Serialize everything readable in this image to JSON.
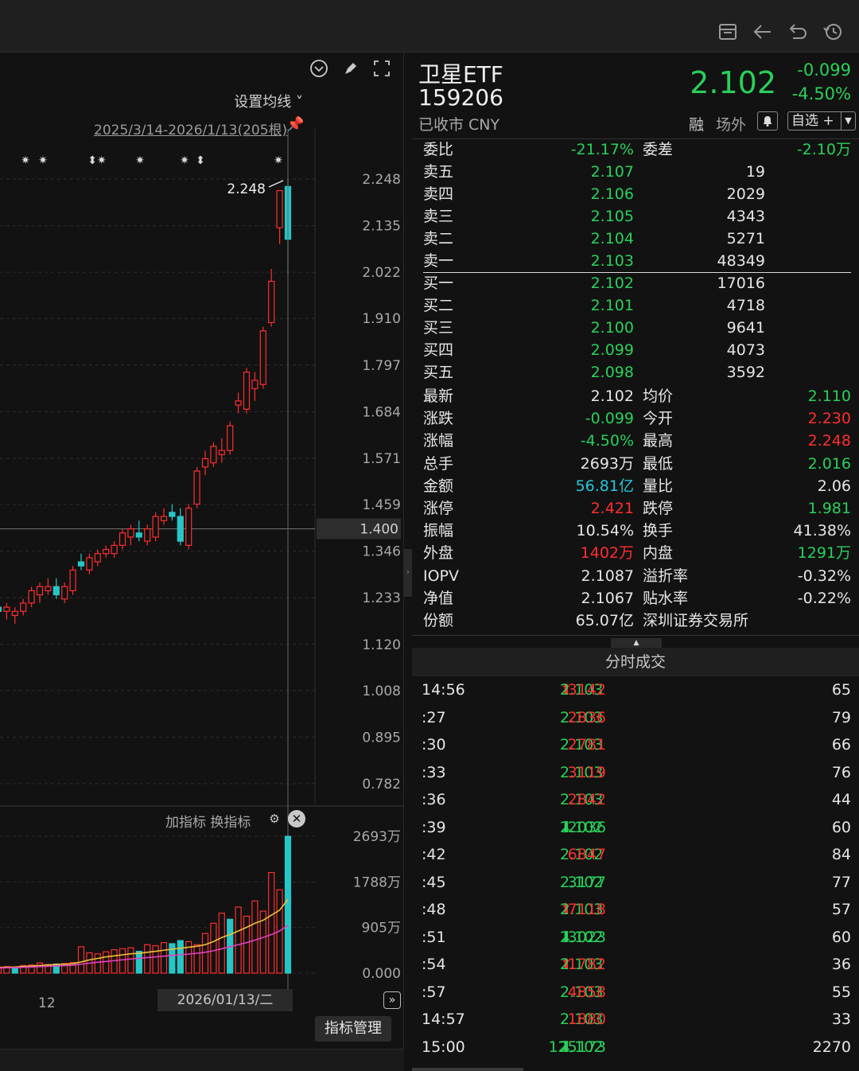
{
  "topbar": {
    "icons": [
      "layout-icon",
      "back-arrow-icon",
      "undo-icon",
      "history-icon"
    ]
  },
  "chart": {
    "ma_setting": "设置均线 ˅",
    "range": "2025/3/14-2026/1/13(205根)",
    "ind_add": "加指标",
    "ind_switch": "换指标",
    "date_box": "2026/01/13/二",
    "x_tick": "12",
    "ind_manage": "指标管理",
    "marker_label": "2.248"
  },
  "chart_data": [
    {
      "type": "candlestick",
      "title": "",
      "y_ticks": [
        "2.248",
        "2.135",
        "2.022",
        "1.910",
        "1.797",
        "1.684",
        "1.571",
        "1.459",
        "1.346",
        "1.233",
        "1.120",
        "1.008",
        "0.895",
        "0.782"
      ],
      "ylim": [
        0.782,
        2.248
      ],
      "crosshair_price": "1.400",
      "max_label": "2.248",
      "candles": [
        {
          "o": 1.21,
          "h": 1.23,
          "l": 1.19,
          "c": 1.2
        },
        {
          "o": 1.2,
          "h": 1.22,
          "l": 1.18,
          "c": 1.21
        },
        {
          "o": 1.19,
          "h": 1.21,
          "l": 1.17,
          "c": 1.2
        },
        {
          "o": 1.2,
          "h": 1.23,
          "l": 1.19,
          "c": 1.22
        },
        {
          "o": 1.22,
          "h": 1.26,
          "l": 1.21,
          "c": 1.25
        },
        {
          "o": 1.24,
          "h": 1.27,
          "l": 1.22,
          "c": 1.26
        },
        {
          "o": 1.25,
          "h": 1.28,
          "l": 1.24,
          "c": 1.26
        },
        {
          "o": 1.26,
          "h": 1.28,
          "l": 1.23,
          "c": 1.24
        },
        {
          "o": 1.23,
          "h": 1.27,
          "l": 1.22,
          "c": 1.26
        },
        {
          "o": 1.25,
          "h": 1.31,
          "l": 1.24,
          "c": 1.3
        },
        {
          "o": 1.32,
          "h": 1.34,
          "l": 1.3,
          "c": 1.31
        },
        {
          "o": 1.3,
          "h": 1.34,
          "l": 1.29,
          "c": 1.33
        },
        {
          "o": 1.32,
          "h": 1.35,
          "l": 1.31,
          "c": 1.34
        },
        {
          "o": 1.34,
          "h": 1.36,
          "l": 1.33,
          "c": 1.35
        },
        {
          "o": 1.34,
          "h": 1.37,
          "l": 1.33,
          "c": 1.36
        },
        {
          "o": 1.36,
          "h": 1.4,
          "l": 1.35,
          "c": 1.39
        },
        {
          "o": 1.38,
          "h": 1.41,
          "l": 1.36,
          "c": 1.4
        },
        {
          "o": 1.39,
          "h": 1.42,
          "l": 1.37,
          "c": 1.38
        },
        {
          "o": 1.37,
          "h": 1.41,
          "l": 1.36,
          "c": 1.4
        },
        {
          "o": 1.38,
          "h": 1.44,
          "l": 1.37,
          "c": 1.43
        },
        {
          "o": 1.42,
          "h": 1.45,
          "l": 1.41,
          "c": 1.43
        },
        {
          "o": 1.44,
          "h": 1.46,
          "l": 1.42,
          "c": 1.43
        },
        {
          "o": 1.43,
          "h": 1.45,
          "l": 1.36,
          "c": 1.37
        },
        {
          "o": 1.36,
          "h": 1.46,
          "l": 1.35,
          "c": 1.45
        },
        {
          "o": 1.46,
          "h": 1.55,
          "l": 1.45,
          "c": 1.54
        },
        {
          "o": 1.55,
          "h": 1.59,
          "l": 1.53,
          "c": 1.57
        },
        {
          "o": 1.56,
          "h": 1.61,
          "l": 1.55,
          "c": 1.6
        },
        {
          "o": 1.58,
          "h": 1.62,
          "l": 1.56,
          "c": 1.59
        },
        {
          "o": 1.59,
          "h": 1.66,
          "l": 1.58,
          "c": 1.65
        },
        {
          "o": 1.7,
          "h": 1.73,
          "l": 1.68,
          "c": 1.71
        },
        {
          "o": 1.69,
          "h": 1.79,
          "l": 1.68,
          "c": 1.78
        },
        {
          "o": 1.74,
          "h": 1.78,
          "l": 1.71,
          "c": 1.76
        },
        {
          "o": 1.75,
          "h": 1.89,
          "l": 1.74,
          "c": 1.88
        },
        {
          "o": 1.9,
          "h": 2.03,
          "l": 1.89,
          "c": 2.0
        },
        {
          "o": 2.13,
          "h": 2.14,
          "l": 2.09,
          "c": 2.22
        },
        {
          "o": 2.23,
          "h": 2.248,
          "l": 2.016,
          "c": 2.102
        }
      ]
    },
    {
      "type": "bar",
      "title": "",
      "y_ticks": [
        "2693万",
        "1788万",
        "905万",
        "0.000"
      ],
      "ylim": [
        0,
        2693
      ],
      "values": [
        120,
        130,
        110,
        150,
        160,
        200,
        170,
        180,
        190,
        210,
        520,
        400,
        380,
        420,
        460,
        480,
        500,
        430,
        560,
        540,
        600,
        580,
        640,
        620,
        560,
        780,
        980,
        1180,
        1060,
        1300,
        1120,
        1420,
        1220,
        1980,
        1640,
        2693
      ],
      "up": [
        true,
        true,
        false,
        true,
        true,
        true,
        true,
        false,
        true,
        true,
        true,
        true,
        true,
        true,
        true,
        true,
        true,
        false,
        true,
        true,
        true,
        false,
        false,
        true,
        true,
        true,
        true,
        true,
        false,
        true,
        true,
        true,
        true,
        true,
        true,
        false
      ],
      "ma_short": [
        110,
        115,
        120,
        130,
        140,
        150,
        160,
        170,
        175,
        185,
        220,
        260,
        290,
        320,
        340,
        360,
        380,
        390,
        410,
        430,
        450,
        470,
        490,
        510,
        530,
        560,
        620,
        700,
        760,
        830,
        900,
        980,
        1040,
        1140,
        1240,
        1450
      ],
      "ma_long": [
        100,
        104,
        108,
        114,
        120,
        128,
        136,
        142,
        148,
        156,
        176,
        196,
        214,
        230,
        246,
        262,
        278,
        292,
        306,
        320,
        334,
        348,
        362,
        376,
        390,
        410,
        440,
        480,
        520,
        560,
        600,
        650,
        700,
        760,
        830,
        940
      ]
    }
  ],
  "security": {
    "name": "卫星ETF",
    "code": "159206",
    "status": "已收市 CNY",
    "price": "2.102",
    "change": "-0.099",
    "change_pct": "-4.50%",
    "tag_rong": "融",
    "tag_chw": "场外",
    "fav": "自选 +"
  },
  "book": {
    "weibi_label": "委比",
    "weibi": "-21.17%",
    "weicha_label": "委差",
    "weicha": "-2.10万",
    "asks": [
      {
        "label": "卖五",
        "price": "2.107",
        "vol": "19"
      },
      {
        "label": "卖四",
        "price": "2.106",
        "vol": "2029"
      },
      {
        "label": "卖三",
        "price": "2.105",
        "vol": "4343"
      },
      {
        "label": "卖二",
        "price": "2.104",
        "vol": "5271"
      },
      {
        "label": "卖一",
        "price": "2.103",
        "vol": "48349"
      }
    ],
    "bids": [
      {
        "label": "买一",
        "price": "2.102",
        "vol": "17016"
      },
      {
        "label": "买二",
        "price": "2.101",
        "vol": "4718"
      },
      {
        "label": "买三",
        "price": "2.100",
        "vol": "9641"
      },
      {
        "label": "买四",
        "price": "2.099",
        "vol": "4073"
      },
      {
        "label": "买五",
        "price": "2.098",
        "vol": "3592"
      }
    ]
  },
  "stats": [
    {
      "l1": "最新",
      "v1": "2.102",
      "c1": "white",
      "l2": "均价",
      "v2": "2.110",
      "c2": "green"
    },
    {
      "l1": "涨跌",
      "v1": "-0.099",
      "c1": "green",
      "l2": "今开",
      "v2": "2.230",
      "c2": "red"
    },
    {
      "l1": "涨幅",
      "v1": "-4.50%",
      "c1": "green",
      "l2": "最高",
      "v2": "2.248",
      "c2": "red"
    },
    {
      "l1": "总手",
      "v1": "2693万",
      "c1": "white",
      "l2": "最低",
      "v2": "2.016",
      "c2": "green"
    },
    {
      "l1": "金额",
      "v1": "56.81亿",
      "c1": "cyan",
      "l2": "量比",
      "v2": "2.06",
      "c2": "white"
    },
    {
      "l1": "涨停",
      "v1": "2.421",
      "c1": "red",
      "l2": "跌停",
      "v2": "1.981",
      "c2": "green"
    },
    {
      "l1": "振幅",
      "v1": "10.54%",
      "c1": "white",
      "l2": "换手",
      "v2": "41.38%",
      "c2": "white"
    },
    {
      "l1": "外盘",
      "v1": "1402万",
      "c1": "red",
      "l2": "内盘",
      "v2": "1291万",
      "c2": "green"
    },
    {
      "l1": "IOPV",
      "v1": "2.1087",
      "c1": "white",
      "l2": "溢折率",
      "v2": "-0.32%",
      "c2": "white"
    },
    {
      "l1": "净值",
      "v1": "2.1067",
      "c1": "white",
      "l2": "贴水率",
      "v2": "-0.22%",
      "c2": "white"
    },
    {
      "l1": "份额",
      "v1": "65.07亿",
      "c1": "white",
      "l2": "深圳证券交易所",
      "v2": "",
      "c2": "white"
    }
  ],
  "ticks": {
    "title": "分时成交",
    "rows": [
      {
        "time": "14:56",
        "price": "2.103",
        "arrow": "up",
        "vol": "3142",
        "vc": "red",
        "cnt": "65"
      },
      {
        "time": ":27",
        "price": "2.103",
        "arrow": "",
        "vol": "2836",
        "vc": "red",
        "cnt": "79"
      },
      {
        "time": ":30",
        "price": "2.103",
        "arrow": "",
        "vol": "2781",
        "vc": "red",
        "cnt": "66"
      },
      {
        "time": ":33",
        "price": "2.103",
        "arrow": "",
        "vol": "3119",
        "vc": "red",
        "cnt": "76"
      },
      {
        "time": ":36",
        "price": "2.103",
        "arrow": "",
        "vol": "2842",
        "vc": "red",
        "cnt": "44"
      },
      {
        "time": ":39",
        "price": "2.102",
        "arrow": "down",
        "vol": "2036",
        "vc": "green",
        "cnt": "60"
      },
      {
        "time": ":42",
        "price": "2.102",
        "arrow": "",
        "vol": "6847",
        "vc": "red",
        "cnt": "84"
      },
      {
        "time": ":45",
        "price": "2.102",
        "arrow": "",
        "vol": "3177",
        "vc": "green",
        "cnt": "77"
      },
      {
        "time": ":48",
        "price": "2.103",
        "arrow": "up",
        "vol": "7118",
        "vc": "red",
        "cnt": "57"
      },
      {
        "time": ":51",
        "price": "2.102",
        "arrow": "down",
        "vol": "3023",
        "vc": "green",
        "cnt": "60"
      },
      {
        "time": ":54",
        "price": "2.103",
        "arrow": "up",
        "vol": "1782",
        "vc": "red",
        "cnt": "36"
      },
      {
        "time": ":57",
        "price": "2.103",
        "arrow": "",
        "vol": "4858",
        "vc": "red",
        "cnt": "55"
      },
      {
        "time": "14:57",
        "price": "2.103",
        "arrow": "",
        "vol": "1880",
        "vc": "red",
        "cnt": "33"
      },
      {
        "time": "15:00",
        "price": "2.102",
        "arrow": "down",
        "vol": "125173",
        "vc": "green",
        "cnt": "2270"
      }
    ]
  },
  "colors": {
    "up": "#ff2e2e",
    "down": "#26c6c6",
    "green": "#2ad05a",
    "ma_yellow": "#e8c23a",
    "ma_pink": "#e040c0"
  }
}
